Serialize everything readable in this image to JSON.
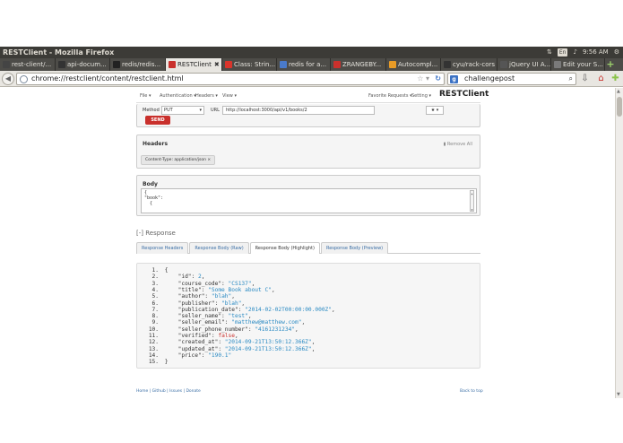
{
  "window": {
    "title": "RESTClient - Mozilla Firefox"
  },
  "tray": {
    "lang": "En",
    "time": "9:56 AM"
  },
  "tabs": [
    {
      "label": "rest-client/...",
      "color": "#444444"
    },
    {
      "label": "api-docum...",
      "color": "#333333"
    },
    {
      "label": "redis/redis...",
      "color": "#222222"
    },
    {
      "label": "RESTClient",
      "color": "#c9302c",
      "active": true
    },
    {
      "label": "Class: Strin...",
      "color": "#d9342b"
    },
    {
      "label": "redis for a...",
      "color": "#4a7ac9"
    },
    {
      "label": "ZRANGEBY...",
      "color": "#c9302c"
    },
    {
      "label": "Autocompl...",
      "color": "#e89b26"
    },
    {
      "label": "cyu/rack-cors",
      "color": "#333333"
    },
    {
      "label": "jQuery UI A...",
      "color": "#555555"
    },
    {
      "label": "Edit your S...",
      "color": "#7a7a7a"
    }
  ],
  "address": {
    "url": "chrome://restclient/content/restclient.html"
  },
  "search": {
    "value": "challengepost"
  },
  "appbar": {
    "file": "File ▾",
    "auth": "Authentication ▾",
    "headers": "Headers ▾",
    "view": "View ▾",
    "favorites": "Favorite Requests ▾",
    "setting": "Setting ▾",
    "brand": "RESTClient"
  },
  "request": {
    "method_label": "Method",
    "method": "PUT",
    "url_label": "URL",
    "url": "http://localhost:3000/api/v1/books/2",
    "send": "SEND"
  },
  "headers_panel": {
    "title": "Headers",
    "remove_all": "Remove All",
    "header": "Content-Type: application/json",
    "remove": "×"
  },
  "body_panel": {
    "title": "Body",
    "line1": "{",
    "line2": "\"book\":",
    "line3": "  {"
  },
  "response": {
    "title": "[-] Response",
    "tabs": [
      "Response Headers",
      "Response Body (Raw)",
      "Response Body (Highlight)",
      "Response Body (Preview)"
    ],
    "active_tab": 2,
    "lines": [
      {
        "n": "1.",
        "t": "{"
      },
      {
        "n": "2.",
        "k": "\"id\"",
        "v": "2",
        "vt": "num"
      },
      {
        "n": "3.",
        "k": "\"course_code\"",
        "v": "\"CS137\"",
        "vt": "str"
      },
      {
        "n": "4.",
        "k": "\"title\"",
        "v": "\"Some Book about C\"",
        "vt": "str"
      },
      {
        "n": "5.",
        "k": "\"author\"",
        "v": "\"blah\"",
        "vt": "str"
      },
      {
        "n": "6.",
        "k": "\"publisher\"",
        "v": "\"blah\"",
        "vt": "str"
      },
      {
        "n": "7.",
        "k": "\"publication_date\"",
        "v": "\"2014-02-02T00:00:00.000Z\"",
        "vt": "str"
      },
      {
        "n": "8.",
        "k": "\"seller_name\"",
        "v": "\"test\"",
        "vt": "str"
      },
      {
        "n": "9.",
        "k": "\"seller_email\"",
        "v": "\"matthew@matthew.com\"",
        "vt": "str"
      },
      {
        "n": "10.",
        "k": "\"seller_phone_number\"",
        "v": "\"4161231234\"",
        "vt": "str"
      },
      {
        "n": "11.",
        "k": "\"verified\"",
        "v": "false",
        "vt": "kw"
      },
      {
        "n": "12.",
        "k": "\"created_at\"",
        "v": "\"2014-09-21T13:50:12.366Z\"",
        "vt": "str"
      },
      {
        "n": "13.",
        "k": "\"updated_at\"",
        "v": "\"2014-09-21T13:50:12.366Z\"",
        "vt": "str"
      },
      {
        "n": "14.",
        "k": "\"price\"",
        "v": "\"190.1\"",
        "vt": "str",
        "last": true
      },
      {
        "n": "15.",
        "t": "}"
      }
    ]
  },
  "footer": {
    "links": "Home | Github | Issues | Donate",
    "back_top": "Back to top"
  }
}
